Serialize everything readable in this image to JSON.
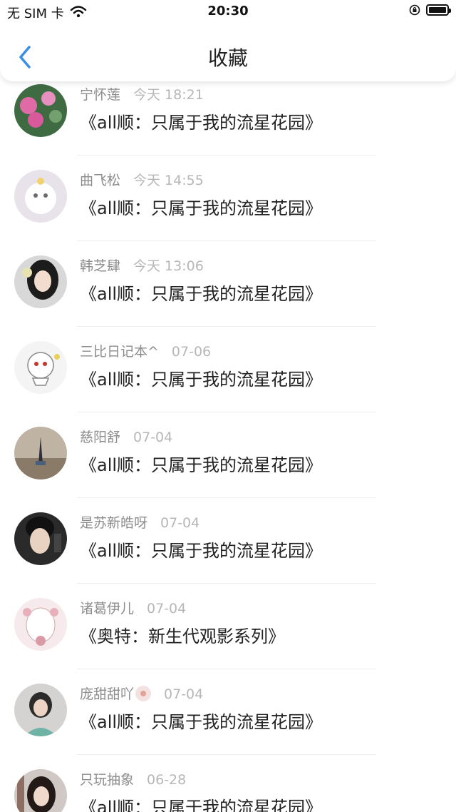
{
  "status_bar": {
    "carrier": "无 SIM 卡",
    "time": "20:30"
  },
  "nav": {
    "title": "收藏"
  },
  "items": [
    {
      "name": "宁怀莲",
      "time": "今天 18:21",
      "title": "《all顺：只属于我的流星花园》"
    },
    {
      "name": "曲飞松",
      "time": "今天 14:55",
      "title": "《all顺：只属于我的流星花园》"
    },
    {
      "name": "韩芝肆",
      "time": "今天 13:06",
      "title": "《all顺：只属于我的流星花园》"
    },
    {
      "name": "三比日记本^",
      "time": "07-06",
      "title": "《all顺：只属于我的流星花园》"
    },
    {
      "name": "慈阳舒",
      "time": "07-04",
      "title": "《all顺：只属于我的流星花园》"
    },
    {
      "name": "是苏新皓呀",
      "time": "07-04",
      "title": "《all顺：只属于我的流星花园》"
    },
    {
      "name": "诸葛伊儿",
      "time": "07-04",
      "title": "《奥特：新生代观影系列》"
    },
    {
      "name": "庞甜甜吖",
      "time": "07-04",
      "title": "《all顺：只属于我的流星花园》"
    },
    {
      "name": "只玩抽象",
      "time": "06-28",
      "title": "《all顺：只属于我的流星花园》"
    }
  ],
  "colors": {
    "accent": "#3a8ee6",
    "name_text": "#8c8c8c",
    "time_text": "#b7b7b7",
    "divider": "#eeeeee"
  },
  "icons": {
    "back": "chevron-left-icon",
    "wifi": "wifi-icon",
    "rotation_lock": "rotation-lock-icon",
    "battery": "battery-icon"
  }
}
